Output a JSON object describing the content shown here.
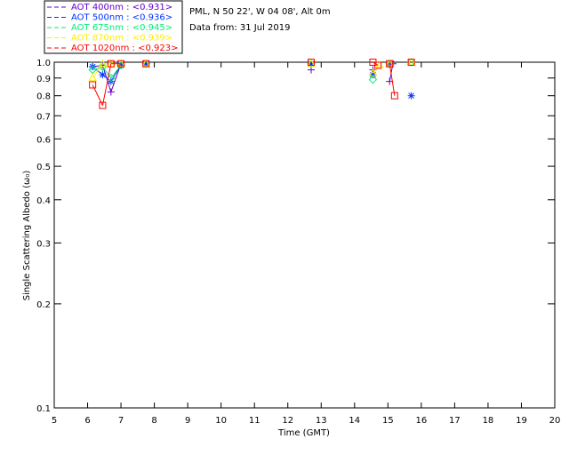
{
  "chart_data": {
    "type": "scatter",
    "header": [
      "PML, N 50 22', W 04 08', Alt 0m",
      "Data from: 31 Jul 2019"
    ],
    "xlabel": "Time (GMT)",
    "ylabel": "Single Scattering Albedo (ω₀)",
    "xlim": [
      5,
      20
    ],
    "ylim": [
      0.1,
      1.0
    ],
    "yscale": "log",
    "xticks": [
      5,
      6,
      7,
      8,
      9,
      10,
      11,
      12,
      13,
      14,
      15,
      16,
      17,
      18,
      19,
      20
    ],
    "yticks": [
      0.1,
      0.2,
      0.3,
      0.4,
      0.5,
      0.6,
      0.7,
      0.8,
      0.9,
      1.0
    ],
    "ytick_labels": [
      "0.1",
      "0.2",
      "0.3",
      "0.4",
      "0.5",
      "0.6",
      "0.7",
      "0.8",
      "0.9",
      "1.0"
    ],
    "legend_position": "top-left, outside",
    "series": [
      {
        "name": "AOT  400nm : <0.931>",
        "color": "#6600cc",
        "marker": "plus",
        "x": [
          6.15,
          6.45,
          6.7,
          7.0,
          7.75,
          12.7,
          14.55,
          15.05,
          15.15
        ],
        "y": [
          0.97,
          0.98,
          0.82,
          0.99,
          0.99,
          0.95,
          0.95,
          0.88,
          0.99
        ]
      },
      {
        "name": "AOT  500nm : <0.936>",
        "color": "#0033ff",
        "marker": "asterisk",
        "x": [
          6.15,
          6.45,
          6.7,
          7.0,
          7.75,
          12.7,
          14.55,
          15.1,
          15.7
        ],
        "y": [
          0.97,
          0.92,
          0.88,
          0.98,
          0.99,
          0.99,
          0.92,
          0.99,
          0.8
        ]
      },
      {
        "name": "AOT  675nm : <0.945>",
        "color": "#00ee77",
        "marker": "diamond",
        "x": [
          6.15,
          6.45,
          6.7,
          7.0,
          7.75,
          12.7,
          14.55,
          15.05,
          15.7
        ],
        "y": [
          0.95,
          0.97,
          0.9,
          0.98,
          0.99,
          0.99,
          0.89,
          0.99,
          1.0
        ]
      },
      {
        "name": "AOT  870nm : <0.939>",
        "color": "#ffee00",
        "marker": "triangle",
        "x": [
          6.15,
          6.45,
          6.7,
          7.0,
          7.75,
          12.7,
          14.55,
          14.75,
          15.05,
          15.7
        ],
        "y": [
          0.9,
          0.99,
          0.99,
          0.99,
          0.99,
          0.99,
          0.93,
          0.98,
          0.99,
          1.0
        ]
      },
      {
        "name": "AOT 1020nm : <0.923>",
        "color": "#ff0000",
        "marker": "square",
        "x": [
          6.15,
          6.45,
          6.7,
          7.0,
          7.75,
          12.7,
          14.55,
          14.7,
          15.05,
          15.2,
          15.7
        ],
        "y": [
          0.86,
          0.75,
          0.99,
          0.99,
          0.99,
          1.0,
          1.0,
          0.98,
          0.99,
          0.8,
          1.0
        ]
      }
    ]
  }
}
